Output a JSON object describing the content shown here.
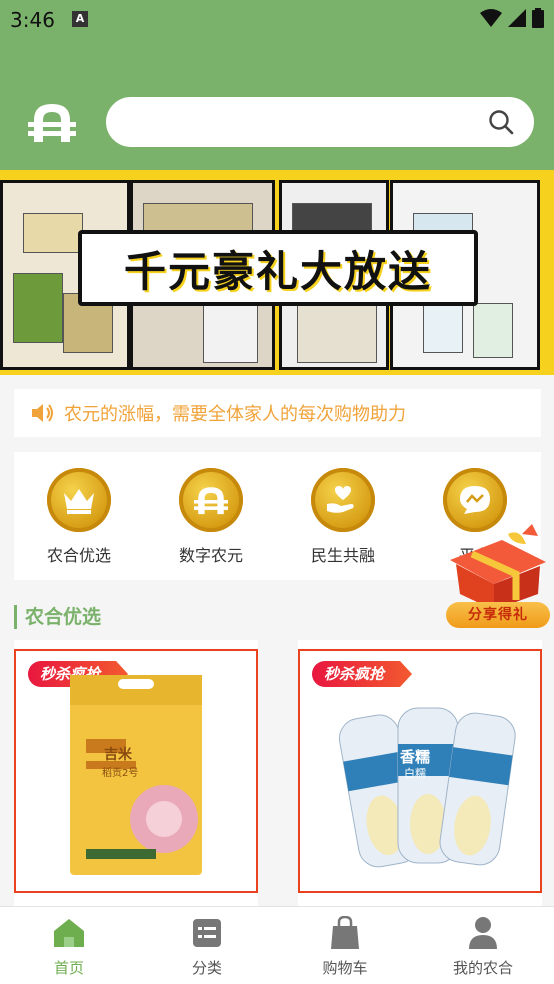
{
  "status_bar": {
    "time": "3:46",
    "notification_badge": "A"
  },
  "search": {
    "placeholder": ""
  },
  "banner": {
    "headline": "千元豪礼大放送"
  },
  "notice": {
    "text": "农元的涨幅，需要全体家人的每次购物助力"
  },
  "categories": [
    {
      "label": "农合优选",
      "icon": "crown-icon"
    },
    {
      "label": "数字农元",
      "icon": "nongyuan-coin-icon"
    },
    {
      "label": "民生共融",
      "icon": "heart-hand-icon"
    },
    {
      "label": "平台",
      "icon": "chat-wave-icon"
    }
  ],
  "share": {
    "label": "分享得礼"
  },
  "section": {
    "title": "农合优选"
  },
  "products": [
    {
      "badge": "秒杀疯抢",
      "package_text": "吉米",
      "sub_text": "稻贡2号"
    },
    {
      "badge": "秒杀疯抢",
      "package_text": "香糯",
      "sub_text": "白糯"
    }
  ],
  "nav": {
    "items": [
      {
        "label": "首页",
        "icon": "home-icon",
        "active": true
      },
      {
        "label": "分类",
        "icon": "category-icon",
        "active": false
      },
      {
        "label": "购物车",
        "icon": "shopping-bag-icon",
        "active": false
      },
      {
        "label": "我的农合",
        "icon": "user-icon",
        "active": false
      }
    ]
  },
  "colors": {
    "header": "#7bb26b",
    "accent": "#6fae4f",
    "notice": "#f0a33a",
    "banner": "#f6d21e",
    "sale": "#e8421f"
  }
}
